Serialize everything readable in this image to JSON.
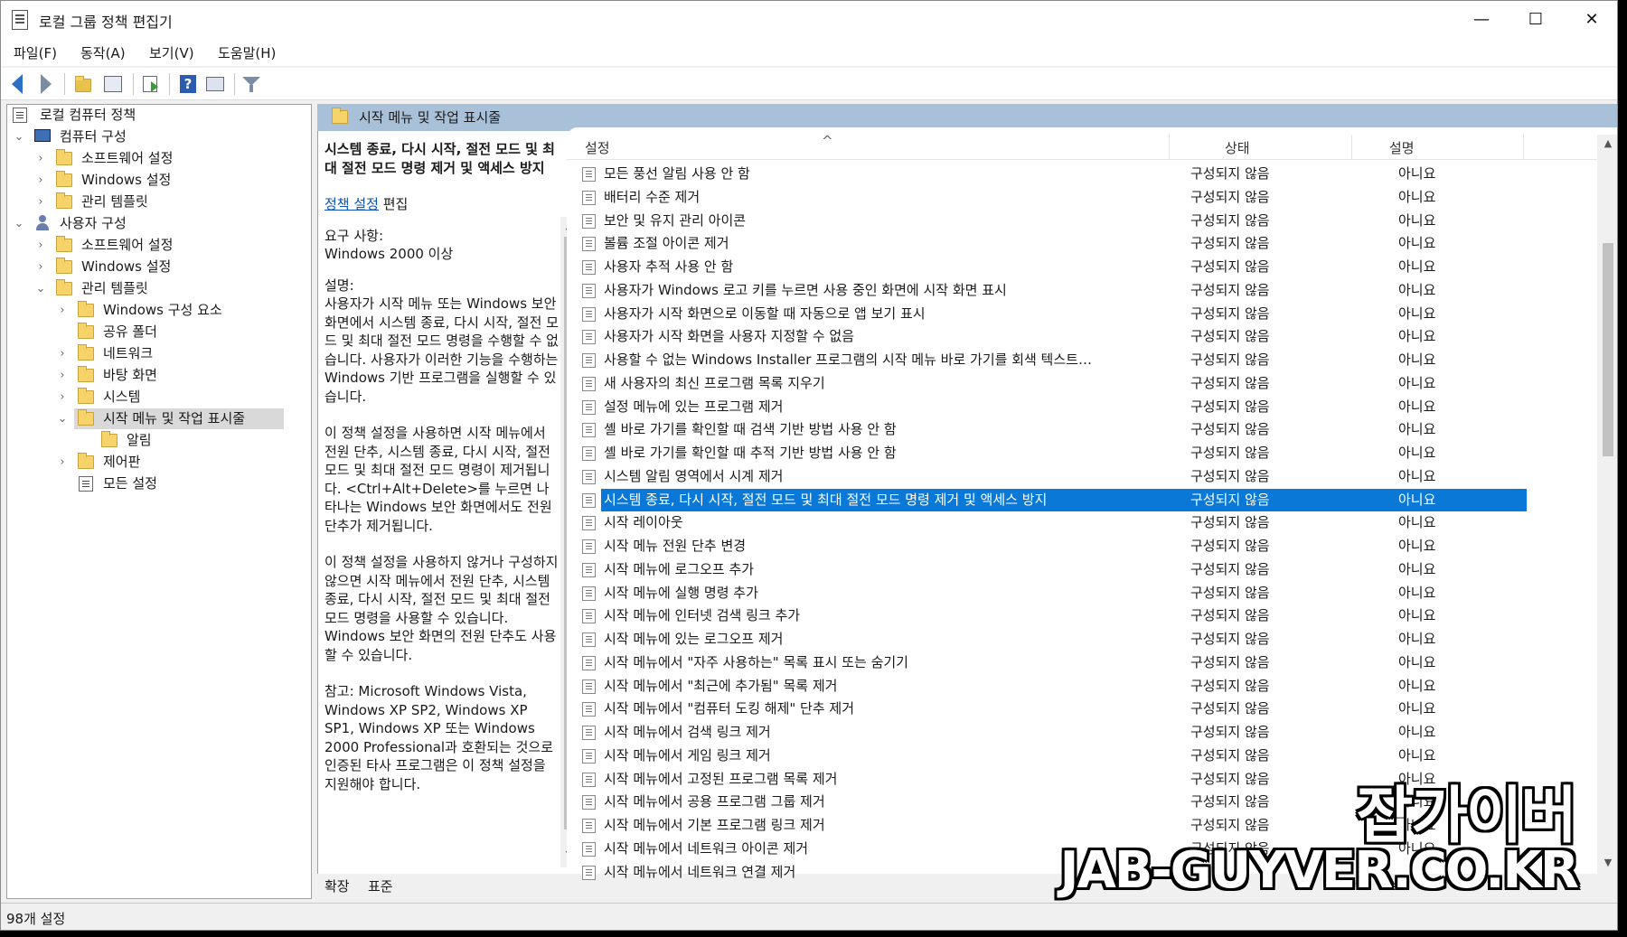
{
  "window": {
    "title": "로컬 그룹 정책 편집기",
    "min_glyph": "—",
    "max_glyph": "☐",
    "close_glyph": "✕"
  },
  "menu": [
    "파일(F)",
    "동작(A)",
    "보기(V)",
    "도움말(H)"
  ],
  "toolbar": {
    "icons": [
      "back-icon",
      "forward-icon",
      "up-folder-icon",
      "show-hide-tree-icon",
      "export-list-icon",
      "help-icon",
      "properties-icon",
      "filter-icon"
    ]
  },
  "tree": {
    "root": "로컬 컴퓨터 정책",
    "computer_config": "컴퓨터 구성",
    "computer_software": "소프트웨어 설정",
    "computer_windows": "Windows 설정",
    "computer_admin": "관리 템플릿",
    "user_config": "사용자 구성",
    "user_software": "소프트웨어 설정",
    "user_windows": "Windows 설정",
    "user_admin": "관리 템플릿",
    "windows_components": "Windows 구성 요소",
    "shared_folders": "공유 폴더",
    "network": "네트워크",
    "desktop": "바탕 화면",
    "system": "시스템",
    "start_menu": "시작 메뉴 및 작업 표시줄",
    "notifications": "알림",
    "control_panel": "제어판",
    "all_settings": "모든 설정"
  },
  "right_header": {
    "title": "시작 메뉴 및 작업 표시줄"
  },
  "description": {
    "title": "시스템 종료, 다시 시작, 절전 모드 및 최대 절전 모드 명령 제거 및 액세스 방지",
    "edit_link": "정책 설정",
    "edit_suffix": " 편집",
    "req_label": "요구 사항:",
    "req_value": "Windows 2000 이상",
    "desc_label": "설명:",
    "para1": "사용자가 시작 메뉴 또는 Windows 보안 화면에서 시스템 종료, 다시 시작, 절전 모드 및 최대 절전 모드 명령을 수행할 수 없습니다. 사용자가 이러한 기능을 수행하는 Windows 기반 프로그램을 실행할 수 있습니다.",
    "para2": "이 정책 설정을 사용하면 시작 메뉴에서 전원 단추, 시스템 종료, 다시 시작, 절전 모드 및 최대 절전 모드 명령이 제거됩니다. <Ctrl+Alt+Delete>를 누르면 나타나는 Windows 보안 화면에서도 전원 단추가 제거됩니다.",
    "para3": "이 정책 설정을 사용하지 않거나 구성하지 않으면 시작 메뉴에서 전원 단추, 시스템 종료, 다시 시작, 절전 모드 및 최대 절전 모드 명령을 사용할 수 있습니다. Windows 보안 화면의 전원 단추도 사용할 수 있습니다.",
    "para4": "참고: Microsoft Windows Vista, Windows XP SP2, Windows XP SP1, Windows XP 또는 Windows 2000 Professional과 호환되는 것으로 인증된 타사 프로그램은 이 정책 설정을 지원해야 합니다."
  },
  "list": {
    "columns": {
      "setting": "설정",
      "state": "상태",
      "comment": "설명"
    },
    "sort_glyph": "^",
    "rows": [
      {
        "setting": "모든 풍선 알림 사용 안 함",
        "state": "구성되지 않음",
        "comment": "아니요"
      },
      {
        "setting": "배터리 수준 제거",
        "state": "구성되지 않음",
        "comment": "아니요"
      },
      {
        "setting": "보안 및 유지 관리 아이콘",
        "state": "구성되지 않음",
        "comment": "아니요"
      },
      {
        "setting": "볼륨 조절 아이콘 제거",
        "state": "구성되지 않음",
        "comment": "아니요"
      },
      {
        "setting": "사용자 추적 사용 안 함",
        "state": "구성되지 않음",
        "comment": "아니요"
      },
      {
        "setting": "사용자가 Windows 로고 키를 누르면 사용 중인 화면에 시작 화면 표시",
        "state": "구성되지 않음",
        "comment": "아니요"
      },
      {
        "setting": "사용자가 시작 화면으로 이동할 때 자동으로 앱 보기 표시",
        "state": "구성되지 않음",
        "comment": "아니요"
      },
      {
        "setting": "사용자가 시작 화면을 사용자 지정할 수 없음",
        "state": "구성되지 않음",
        "comment": "아니요"
      },
      {
        "setting": "사용할 수 없는 Windows Installer 프로그램의 시작 메뉴 바로 가기를 회색 텍스트로 ...",
        "state": "구성되지 않음",
        "comment": "아니요"
      },
      {
        "setting": "새 사용자의 최신 프로그램 목록 지우기",
        "state": "구성되지 않음",
        "comment": "아니요"
      },
      {
        "setting": "설정 메뉴에 있는 프로그램 제거",
        "state": "구성되지 않음",
        "comment": "아니요"
      },
      {
        "setting": "셸 바로 가기를 확인할 때 검색 기반 방법 사용 안 함",
        "state": "구성되지 않음",
        "comment": "아니요"
      },
      {
        "setting": "셸 바로 가기를 확인할 때 추적 기반 방법 사용 안 함",
        "state": "구성되지 않음",
        "comment": "아니요"
      },
      {
        "setting": "시스템 알림 영역에서 시계 제거",
        "state": "구성되지 않음",
        "comment": "아니요"
      },
      {
        "setting": "시스템 종료, 다시 시작, 절전 모드 및 최대 절전 모드 명령 제거 및 액세스 방지",
        "state": "구성되지 않음",
        "comment": "아니요",
        "selected": true
      },
      {
        "setting": "시작 레이아웃",
        "state": "구성되지 않음",
        "comment": "아니요"
      },
      {
        "setting": "시작 메뉴 전원 단추 변경",
        "state": "구성되지 않음",
        "comment": "아니요"
      },
      {
        "setting": "시작 메뉴에 로그오프 추가",
        "state": "구성되지 않음",
        "comment": "아니요"
      },
      {
        "setting": "시작 메뉴에 실행 명령 추가",
        "state": "구성되지 않음",
        "comment": "아니요"
      },
      {
        "setting": "시작 메뉴에 인터넷 검색 링크 추가",
        "state": "구성되지 않음",
        "comment": "아니요"
      },
      {
        "setting": "시작 메뉴에 있는 로그오프 제거",
        "state": "구성되지 않음",
        "comment": "아니요"
      },
      {
        "setting": "시작 메뉴에서 \"자주 사용하는\" 목록 표시 또는 숨기기",
        "state": "구성되지 않음",
        "comment": "아니요"
      },
      {
        "setting": "시작 메뉴에서 \"최근에 추가됨\" 목록 제거",
        "state": "구성되지 않음",
        "comment": "아니요"
      },
      {
        "setting": "시작 메뉴에서 \"컴퓨터 도킹 해제\" 단추 제거",
        "state": "구성되지 않음",
        "comment": "아니요"
      },
      {
        "setting": "시작 메뉴에서 검색 링크 제거",
        "state": "구성되지 않음",
        "comment": "아니요"
      },
      {
        "setting": "시작 메뉴에서 게임 링크 제거",
        "state": "구성되지 않음",
        "comment": "아니요"
      },
      {
        "setting": "시작 메뉴에서 고정된 프로그램 목록 제거",
        "state": "구성되지 않음",
        "comment": "아니요"
      },
      {
        "setting": "시작 메뉴에서 공용 프로그램 그룹 제거",
        "state": "구성되지 않음",
        "comment": "아니요"
      },
      {
        "setting": "시작 메뉴에서 기본 프로그램 링크 제거",
        "state": "구성되지 않음",
        "comment": "아니요"
      },
      {
        "setting": "시작 메뉴에서 네트워크 아이콘 제거",
        "state": "구성되지 않음",
        "comment": "아니요"
      },
      {
        "setting": "시작 메뉴에서 네트워크 연결 제거",
        "state": "",
        "comment": ""
      }
    ]
  },
  "tabs": {
    "extended": "확장",
    "standard": "표준"
  },
  "status": "98개 설정",
  "watermark": {
    "korean": "잡가이버",
    "url": "JAB-GUYVER.CO.KR"
  },
  "colors": {
    "selection": "#0a78d7",
    "header_band": "#a8c0d8",
    "link": "#0b54b4"
  }
}
